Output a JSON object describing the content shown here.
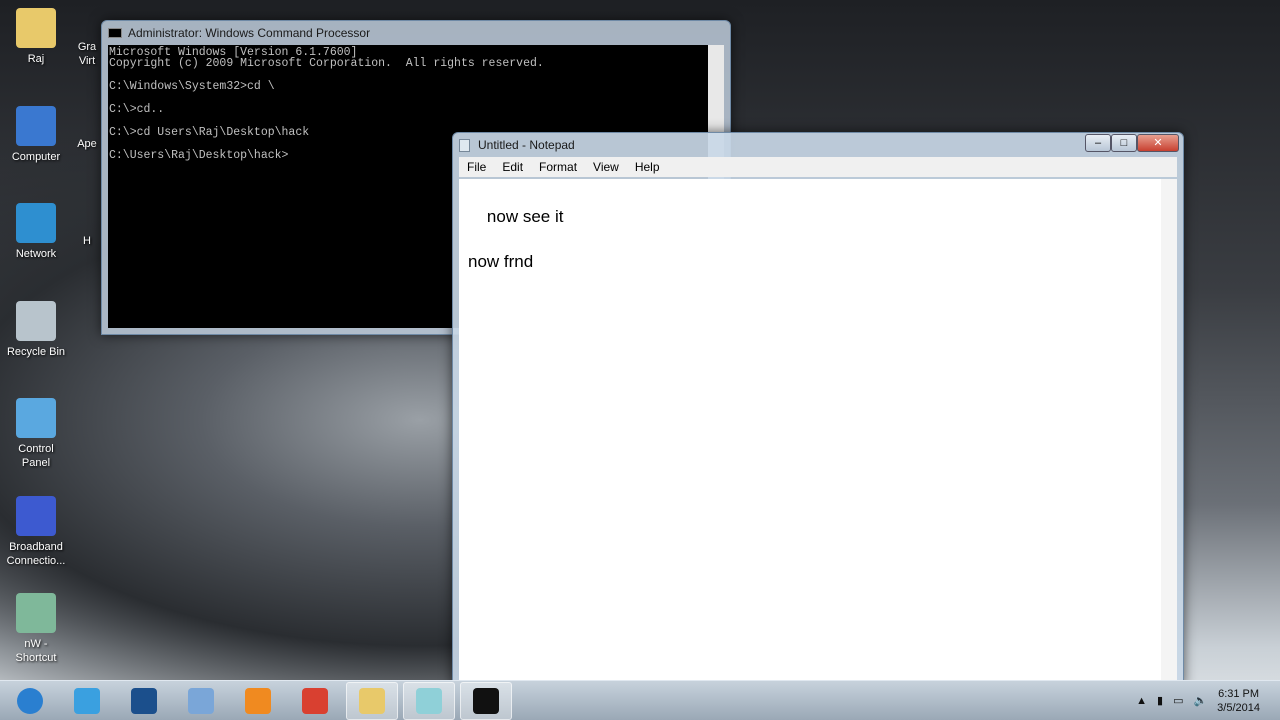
{
  "desktop_icons": [
    {
      "label": "Raj",
      "icon": "user-folder-icon",
      "color": "#e8c96a"
    },
    {
      "label": "Computer",
      "icon": "computer-icon",
      "color": "#3a78d0"
    },
    {
      "label": "Network",
      "icon": "network-icon",
      "color": "#2e8fd0"
    },
    {
      "label": "Recycle Bin",
      "icon": "recycle-bin-icon",
      "color": "#b8c4cc"
    },
    {
      "label": "Control Panel",
      "icon": "control-panel-icon",
      "color": "#5aa8e0"
    },
    {
      "label": "Broadband Connectio...",
      "icon": "broadband-connection-icon",
      "color": "#3d5ad0"
    },
    {
      "label": "nW - Shortcut",
      "icon": "shortcut-icon",
      "color": "#7fb89a"
    }
  ],
  "partial_icons": [
    "Gra Virt",
    "Ape",
    "H"
  ],
  "cmd": {
    "title": "Administrator: Windows Command Processor",
    "lines": [
      "Microsoft Windows [Version 6.1.7600]",
      "Copyright (c) 2009 Microsoft Corporation.  All rights reserved.",
      "",
      "C:\\Windows\\System32>cd \\",
      "",
      "C:\\>cd..",
      "",
      "C:\\>cd Users\\Raj\\Desktop\\hack",
      "",
      "C:\\Users\\Raj\\Desktop\\hack>"
    ]
  },
  "notepad": {
    "title": "Untitled - Notepad",
    "menu": [
      "File",
      "Edit",
      "Format",
      "View",
      "Help"
    ],
    "content": "now see it\n\nnow frnd"
  },
  "window_controls": {
    "minimize": "–",
    "maximize": "□",
    "close": "✕"
  },
  "taskbar": {
    "items": [
      {
        "name": "start-button",
        "color": "#2a7fd0"
      },
      {
        "name": "internet-explorer",
        "color": "#3aa0e0"
      },
      {
        "name": "photoshop",
        "color": "#1b4f8c"
      },
      {
        "name": "computer",
        "color": "#7aa6d8"
      },
      {
        "name": "media-player",
        "color": "#f08a20"
      },
      {
        "name": "chrome",
        "color": "#d94030"
      },
      {
        "name": "windows-explorer",
        "color": "#e8c96a"
      },
      {
        "name": "notepad",
        "color": "#8fd0d8"
      },
      {
        "name": "command-prompt",
        "color": "#111111"
      }
    ],
    "time": "6:31 PM",
    "date": "3/5/2014"
  }
}
